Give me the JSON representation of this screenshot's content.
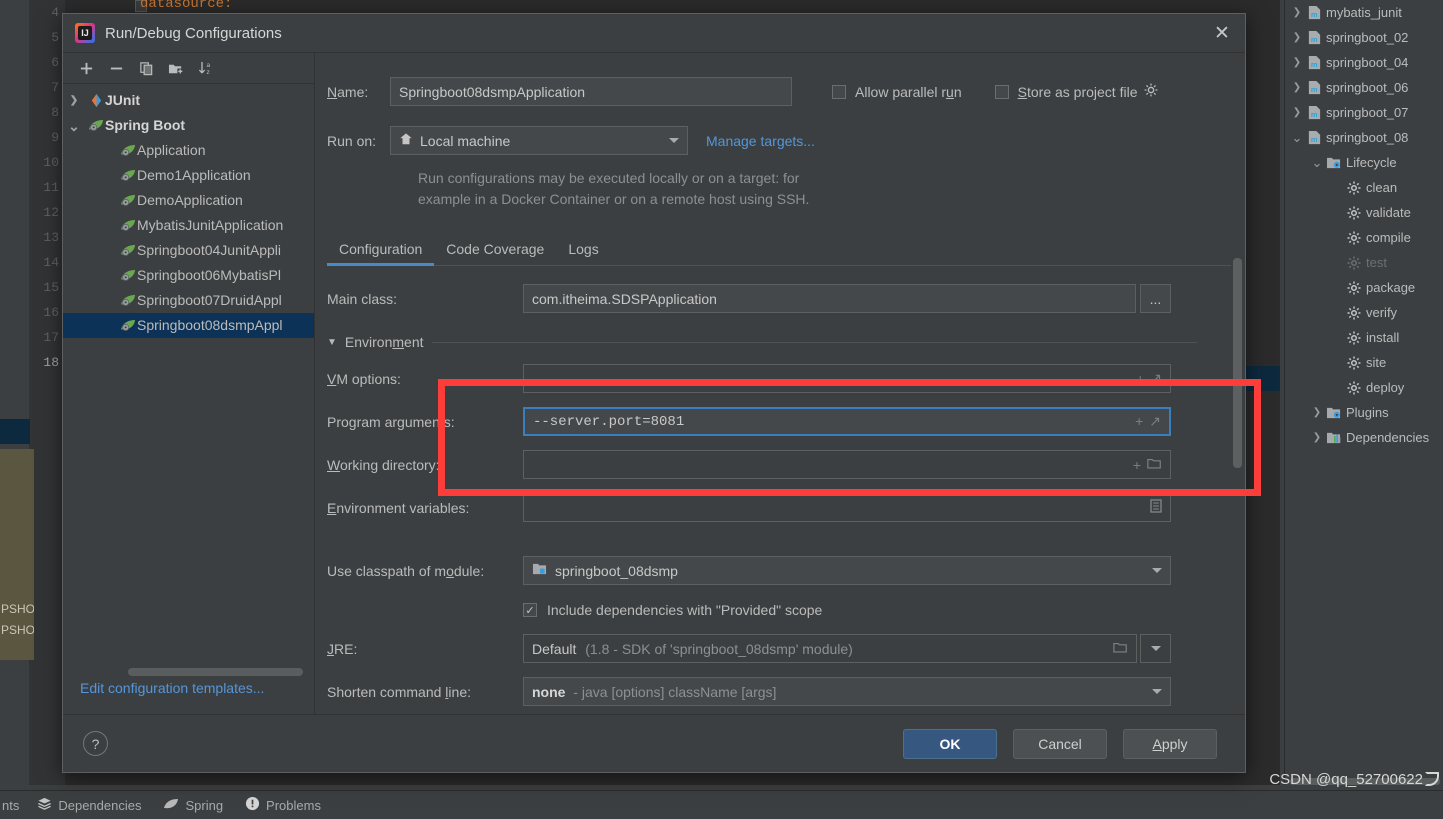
{
  "ide": {
    "editor": {
      "line_numbers": [
        "4",
        "5",
        "6",
        "7",
        "8",
        "9",
        "10",
        "11",
        "12",
        "13",
        "14",
        "15",
        "16",
        "17",
        "18"
      ],
      "code_fragment": "datasource:"
    },
    "tooltip_fragments": [
      "PSHO",
      "PSHO"
    ],
    "maven_panel": {
      "rows": [
        {
          "label": "mybatis_junit",
          "arrow": "›",
          "icon": "maven-module-icon",
          "indent": 0,
          "dim": false
        },
        {
          "label": "springboot_02",
          "arrow": "›",
          "icon": "maven-module-icon",
          "indent": 0,
          "dim": false
        },
        {
          "label": "springboot_04",
          "arrow": "›",
          "icon": "maven-module-icon",
          "indent": 0,
          "dim": false
        },
        {
          "label": "springboot_06",
          "arrow": "›",
          "icon": "maven-module-icon",
          "indent": 0,
          "dim": false
        },
        {
          "label": "springboot_07",
          "arrow": "›",
          "icon": "maven-module-icon",
          "indent": 0,
          "dim": false
        },
        {
          "label": "springboot_08",
          "arrow": "⌄",
          "icon": "maven-module-icon",
          "indent": 0,
          "dim": false
        },
        {
          "label": "Lifecycle",
          "arrow": "⌄",
          "icon": "lifecycle-folder-icon",
          "indent": 1,
          "dim": false
        },
        {
          "label": "clean",
          "arrow": "",
          "icon": "gear-icon",
          "indent": 2,
          "dim": false
        },
        {
          "label": "validate",
          "arrow": "",
          "icon": "gear-icon",
          "indent": 2,
          "dim": false
        },
        {
          "label": "compile",
          "arrow": "",
          "icon": "gear-icon",
          "indent": 2,
          "dim": false
        },
        {
          "label": "test",
          "arrow": "",
          "icon": "gear-icon",
          "indent": 2,
          "dim": true
        },
        {
          "label": "package",
          "arrow": "",
          "icon": "gear-icon",
          "indent": 2,
          "dim": false
        },
        {
          "label": "verify",
          "arrow": "",
          "icon": "gear-icon",
          "indent": 2,
          "dim": false
        },
        {
          "label": "install",
          "arrow": "",
          "icon": "gear-icon",
          "indent": 2,
          "dim": false
        },
        {
          "label": "site",
          "arrow": "",
          "icon": "gear-icon",
          "indent": 2,
          "dim": false
        },
        {
          "label": "deploy",
          "arrow": "",
          "icon": "gear-icon",
          "indent": 2,
          "dim": false
        },
        {
          "label": "Plugins",
          "arrow": "›",
          "icon": "plugins-folder-icon",
          "indent": 1,
          "dim": false
        },
        {
          "label": "Dependencies",
          "arrow": "›",
          "icon": "dependencies-icon",
          "indent": 1,
          "dim": false
        }
      ]
    },
    "statusbar": {
      "left_fragment": "nts",
      "items": [
        {
          "label": "Dependencies",
          "icon": "layers-icon"
        },
        {
          "label": "Spring",
          "icon": "spring-leaf-icon"
        },
        {
          "label": "Problems",
          "icon": "warning-icon"
        }
      ]
    },
    "watermark": "CSDN @qq_52700622"
  },
  "dialog": {
    "title": "Run/Debug Configurations",
    "close_label": "✕",
    "toolbar": [
      {
        "name": "add-configuration-button",
        "glyph": "+"
      },
      {
        "name": "remove-configuration-button",
        "glyph": "−"
      },
      {
        "name": "copy-configuration-button",
        "glyph": "copy-icon"
      },
      {
        "name": "new-folder-button",
        "glyph": "folder-add-icon"
      },
      {
        "name": "sort-configurations-button",
        "glyph": "sort-az-icon"
      }
    ],
    "tree": [
      {
        "label": "JUnit",
        "arrow": "›",
        "icon": "junit-icon",
        "indent": 0,
        "bold": true,
        "selected": false
      },
      {
        "label": "Spring Boot",
        "arrow": "⌄",
        "icon": "spring-boot-icon",
        "indent": 0,
        "bold": true,
        "selected": false
      },
      {
        "label": "Application",
        "arrow": "",
        "icon": "spring-boot-icon",
        "indent": 1,
        "bold": false,
        "selected": false
      },
      {
        "label": "Demo1Application",
        "arrow": "",
        "icon": "spring-boot-icon",
        "indent": 1,
        "bold": false,
        "selected": false
      },
      {
        "label": "DemoApplication",
        "arrow": "",
        "icon": "spring-boot-icon",
        "indent": 1,
        "bold": false,
        "selected": false
      },
      {
        "label": "MybatisJunitApplication",
        "arrow": "",
        "icon": "spring-boot-icon",
        "indent": 1,
        "bold": false,
        "selected": false
      },
      {
        "label": "Springboot04JunitAppli",
        "arrow": "",
        "icon": "spring-boot-icon",
        "indent": 1,
        "bold": false,
        "selected": false
      },
      {
        "label": "Springboot06MybatisPl",
        "arrow": "",
        "icon": "spring-boot-icon",
        "indent": 1,
        "bold": false,
        "selected": false
      },
      {
        "label": "Springboot07DruidAppl",
        "arrow": "",
        "icon": "spring-boot-icon",
        "indent": 1,
        "bold": false,
        "selected": false
      },
      {
        "label": "Springboot08dsmpAppl",
        "arrow": "",
        "icon": "spring-boot-icon",
        "indent": 1,
        "bold": false,
        "selected": true
      }
    ],
    "edit_templates_link": "Edit configuration templates...",
    "form": {
      "name_label": "Name:",
      "name_value": "Springboot08dsmpApplication",
      "allow_parallel_run_label": "Allow parallel run",
      "allow_parallel_run_checked": false,
      "store_as_project_file_label": "Store as project file",
      "store_as_project_file_checked": false,
      "run_on_label": "Run on:",
      "run_on_value": "Local machine",
      "manage_targets_link": "Manage targets...",
      "run_on_hint_line1": "Run configurations may be executed locally or on a target: for",
      "run_on_hint_line2": "example in a Docker Container or on a remote host using SSH.",
      "tabs": [
        {
          "label": "Configuration",
          "active": true
        },
        {
          "label": "Code Coverage",
          "active": false
        },
        {
          "label": "Logs",
          "active": false
        }
      ],
      "main_class_label": "Main class:",
      "main_class_value": "com.itheima.SDSPApplication",
      "browse_label": "...",
      "environment_section_label": "Environment",
      "vm_options_label": "VM options:",
      "vm_options_value": "",
      "program_arguments_label": "Program arguments:",
      "program_arguments_value": "--server.port=8081",
      "working_directory_label": "Working directory:",
      "working_directory_value": "",
      "environment_variables_label": "Environment variables:",
      "environment_variables_value": "",
      "classpath_module_label": "Use classpath of module:",
      "classpath_module_value": "springboot_08dsmp",
      "include_provided_label": "Include dependencies with \"Provided\" scope",
      "include_provided_checked": true,
      "jre_label": "JRE:",
      "jre_value": "Default",
      "jre_value_hint": "(1.8 - SDK of 'springboot_08dsmp' module)",
      "shorten_cmd_label": "Shorten command line:",
      "shorten_cmd_value": "none",
      "shorten_cmd_hint": "- java [options] className [args]"
    },
    "buttons": {
      "help": "?",
      "ok": "OK",
      "cancel": "Cancel",
      "apply": "Apply"
    }
  },
  "annotation": {
    "highlight_color": "#fc3d39",
    "highlight_target": "program-arguments-row"
  }
}
